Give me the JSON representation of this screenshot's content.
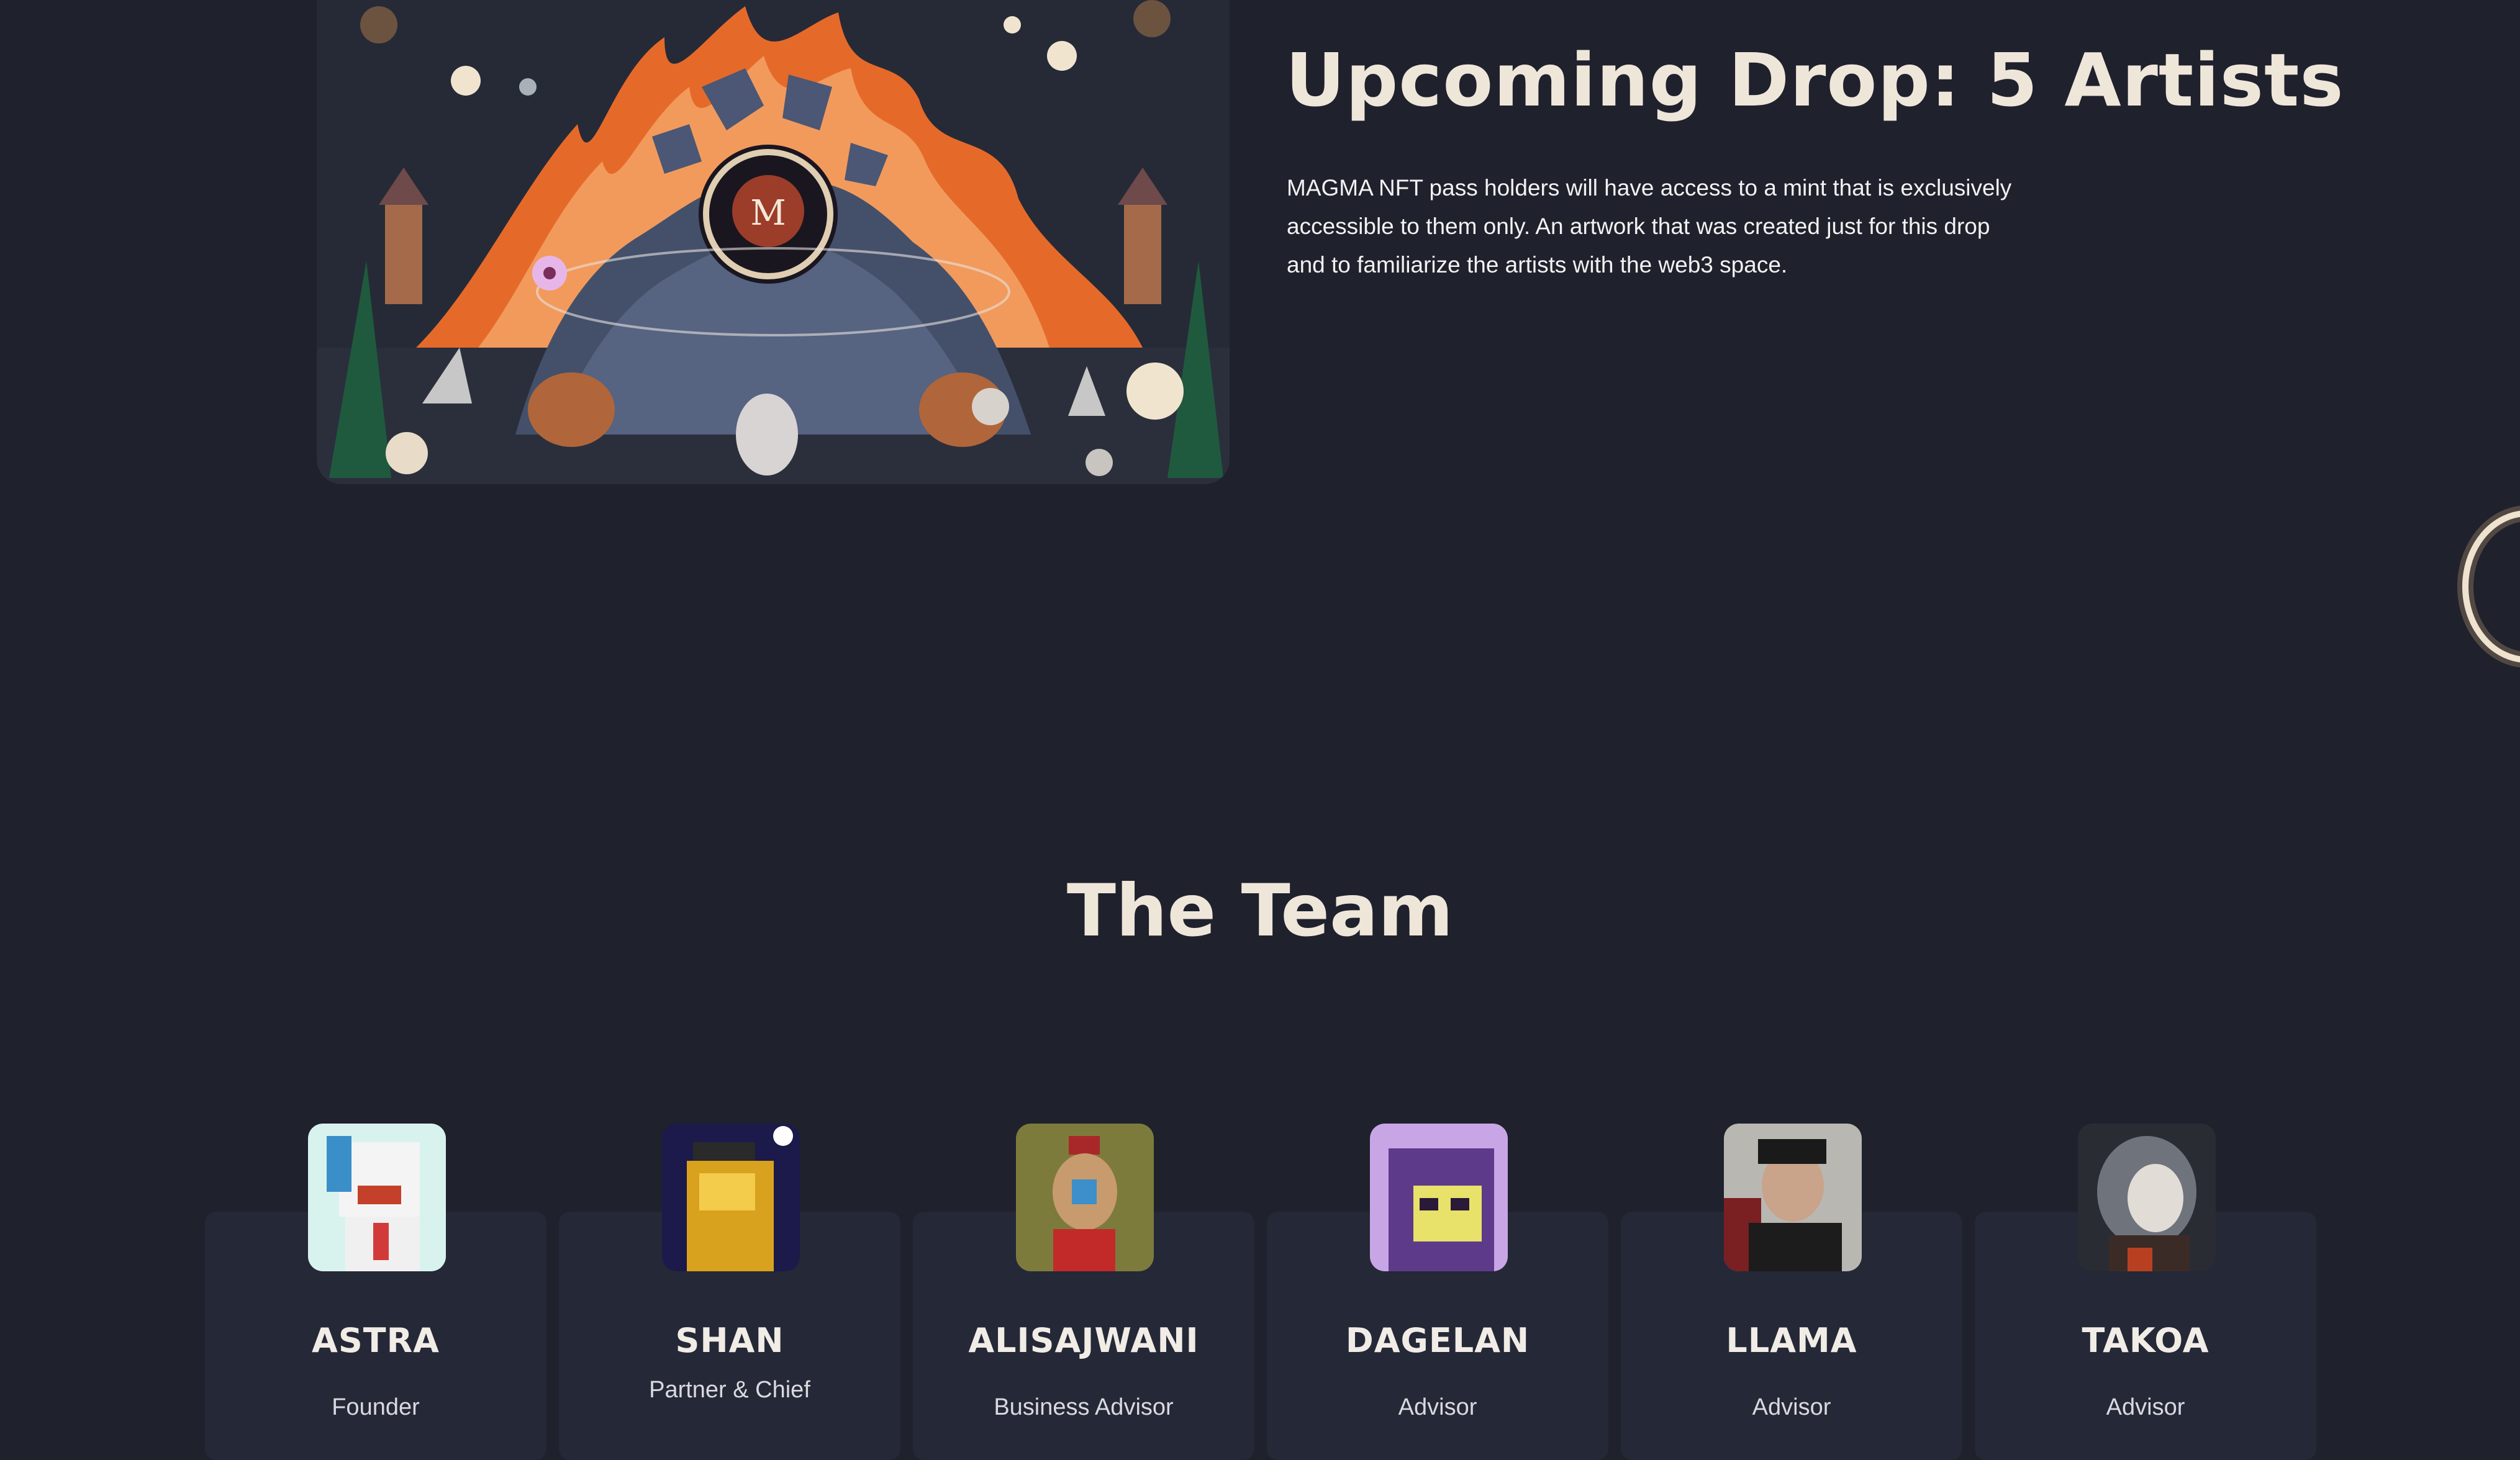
{
  "drop": {
    "title": "Upcoming Drop: 5 Artists",
    "description": "MAGMA NFT pass holders will have access to a mint that is exclusively accessible to them only. An artwork that was created just for this drop and to familiarize the artists with the web3 space.",
    "art_logo_letter": "M"
  },
  "team": {
    "title": "The Team",
    "members": [
      {
        "name": "ASTRA",
        "role": "Founder"
      },
      {
        "name": "SHAN",
        "role": "Partner & Chief"
      },
      {
        "name": "ALISAJWANI",
        "role": "Business Advisor"
      },
      {
        "name": "DAGELAN",
        "role": "Advisor"
      },
      {
        "name": "LLAMA",
        "role": "Advisor"
      },
      {
        "name": "TAKOA",
        "role": "Advisor"
      }
    ]
  },
  "colors": {
    "background": "#1f212d",
    "card": "#252836",
    "heading": "#efe6da",
    "fire": "#e56a2a"
  },
  "icons": [
    "magma-m-logo-icon",
    "glowing-ring-icon"
  ]
}
